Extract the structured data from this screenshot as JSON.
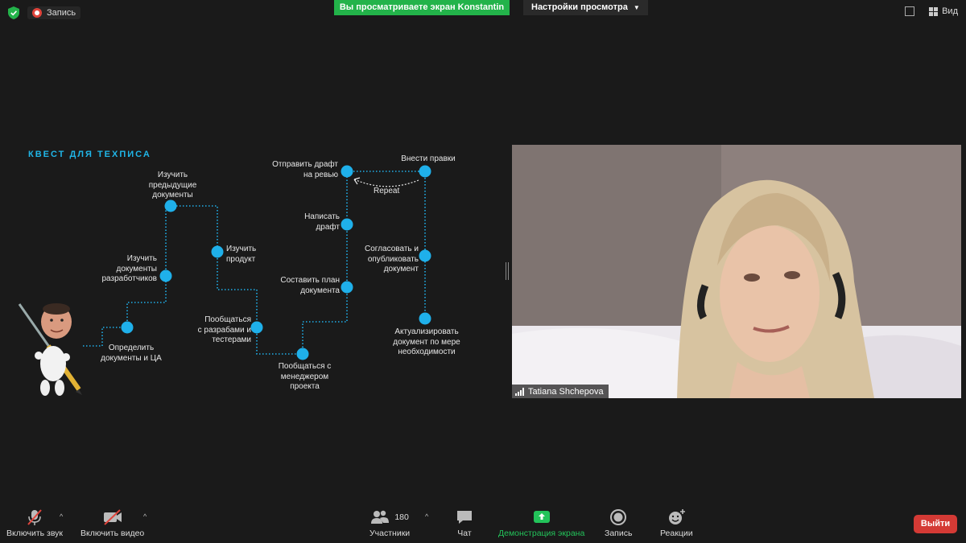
{
  "topbar": {
    "recording_label": "Запись",
    "share_banner": "Вы просматриваете экран Konstantin",
    "view_options": "Настройки просмотра",
    "view_label": "Вид"
  },
  "slide": {
    "title": "КВЕСТ ДЛЯ ТЕХПИСА",
    "nodes": {
      "define_docs": "Определить\nдокументы и ЦА",
      "study_dev_docs": "Изучить\nдокументы\nразработчиков",
      "study_prev_docs": "Изучить\nпредыдущие\nдокументы",
      "study_product": "Изучить\nпродукт",
      "talk_devs_testers": "Пообщаться\nс разрабами и\nтестерами",
      "talk_pm": "Пообщаться с\nменеджером\nпроекта",
      "make_plan": "Составить план\nдокумента",
      "write_draft": "Написать\nдрафт",
      "send_review": "Отправить драфт\nна ревью",
      "make_edits": "Внести правки",
      "repeat": "Repeat",
      "approve_publish": "Согласовать и\nопубликовать\nдокумент",
      "update_doc": "Актуализировать\nдокумент по мере\nнеобходимости"
    },
    "colors": {
      "accent": "#20b6e8",
      "node": "#1fb0ea"
    }
  },
  "video": {
    "participant_name": "Tatiana Shchepova"
  },
  "toolbar": {
    "mute_label": "Включить звук",
    "video_label": "Включить видео",
    "participants_label": "Участники",
    "participants_count": "180",
    "chat_label": "Чат",
    "share_label": "Демонстрация экрана",
    "record_label": "Запись",
    "reactions_label": "Реакции",
    "leave_label": "Выйти"
  }
}
